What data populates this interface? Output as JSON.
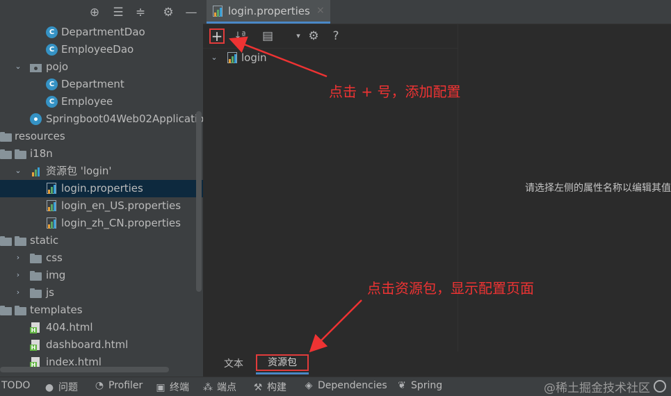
{
  "project_toolbar": {
    "icons": [
      "crosshair-icon",
      "expand-all-icon",
      "collapse-all-icon",
      "gear-icon",
      "minimize-icon"
    ]
  },
  "tree": [
    {
      "label": "DepartmentDao",
      "icon": "class-icon"
    },
    {
      "label": "EmployeeDao",
      "icon": "class-icon"
    },
    {
      "label": "pojo",
      "icon": "package-icon"
    },
    {
      "label": "Department",
      "icon": "class-icon"
    },
    {
      "label": "Employee",
      "icon": "class-icon"
    },
    {
      "label": "Springboot04Web02Applicatio",
      "icon": "spring-app-icon"
    },
    {
      "label": "resources",
      "icon": "folder-icon"
    },
    {
      "label": "i18n",
      "icon": "folder-icon"
    },
    {
      "label": "资源包 'login'",
      "icon": "resource-bundle-icon"
    },
    {
      "label": "login.properties",
      "icon": "properties-icon"
    },
    {
      "label": "login_en_US.properties",
      "icon": "properties-icon"
    },
    {
      "label": "login_zh_CN.properties",
      "icon": "properties-icon"
    },
    {
      "label": "static",
      "icon": "folder-icon"
    },
    {
      "label": "css",
      "icon": "folder-icon"
    },
    {
      "label": "img",
      "icon": "folder-icon"
    },
    {
      "label": "js",
      "icon": "folder-icon"
    },
    {
      "label": "templates",
      "icon": "folder-icon"
    },
    {
      "label": "404.html",
      "icon": "html-icon"
    },
    {
      "label": "dashboard.html",
      "icon": "html-icon"
    },
    {
      "label": "index.html",
      "icon": "html-icon"
    }
  ],
  "editor": {
    "tab_title": "login.properties",
    "tab_close": "×",
    "toolbar": {
      "add": "+",
      "sort": "↓ª",
      "group": "▤",
      "gear": "⚙",
      "help": "?"
    },
    "bundle_root": "login",
    "hint": "请选择左侧的属性名称以编辑其值",
    "bottom_tabs": {
      "text": "文本",
      "bundle": "资源包"
    }
  },
  "annotations": {
    "add_hint": "点击 + 号，添加配置",
    "bundle_hint": "点击资源包，显示配置页面"
  },
  "statusbar": {
    "items": [
      {
        "label": "TODO",
        "icon": "list-icon"
      },
      {
        "label": "问题",
        "icon": "problems-icon"
      },
      {
        "label": "Profiler",
        "icon": "profiler-icon"
      },
      {
        "label": "终端",
        "icon": "terminal-icon"
      },
      {
        "label": "端点",
        "icon": "endpoints-icon"
      },
      {
        "label": "构建",
        "icon": "hammer-icon"
      },
      {
        "label": "Dependencies",
        "icon": "dependencies-icon"
      },
      {
        "label": "Spring",
        "icon": "spring-icon"
      }
    ],
    "watermark": "@稀土掘金技术社区"
  },
  "colors": {
    "annotation": "#e23b3b",
    "selection": "#0d293e",
    "accent": "#4a88c7"
  }
}
